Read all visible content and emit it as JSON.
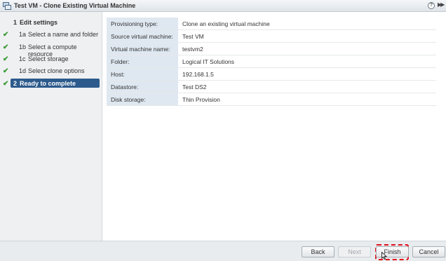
{
  "window": {
    "title": "Test VM - Clone Existing Virtual Machine"
  },
  "steps": [
    {
      "num": "1",
      "label": "Edit settings",
      "completed": false,
      "active": false
    },
    {
      "num": "1a",
      "label": "Select a name and folder",
      "completed": true,
      "active": false
    },
    {
      "num": "1b",
      "label": "Select a compute resource",
      "completed": true,
      "active": false
    },
    {
      "num": "1c",
      "label": "Select storage",
      "completed": true,
      "active": false
    },
    {
      "num": "1d",
      "label": "Select clone options",
      "completed": true,
      "active": false
    },
    {
      "num": "2",
      "label": "Ready to complete",
      "completed": true,
      "active": true
    }
  ],
  "summary": [
    {
      "key": "Provisioning type:",
      "value": "Clone an existing virtual machine"
    },
    {
      "key": "Source virtual machine:",
      "value": "Test VM"
    },
    {
      "key": "Virtual machine name:",
      "value": "testvm2"
    },
    {
      "key": "Folder:",
      "value": "Logical IT Solutions"
    },
    {
      "key": "Host:",
      "value": "192.168.1.5"
    },
    {
      "key": "Datastore:",
      "value": "Test DS2"
    },
    {
      "key": "Disk storage:",
      "value": "Thin Provision"
    }
  ],
  "buttons": {
    "back": "Back",
    "next": "Next",
    "finish": "Finish",
    "cancel": "Cancel"
  },
  "icons": {
    "title": "vm-clone-icon",
    "help": "help-icon",
    "expand": "double-chevron-right-icon",
    "check": "checkmark-icon",
    "cursor": "mouse-pointer-icon"
  },
  "colors": {
    "active_step": "#2c5a8c",
    "check": "#3a9a35",
    "highlight": "#e0101a",
    "label_bg": "#dfe8f1"
  }
}
